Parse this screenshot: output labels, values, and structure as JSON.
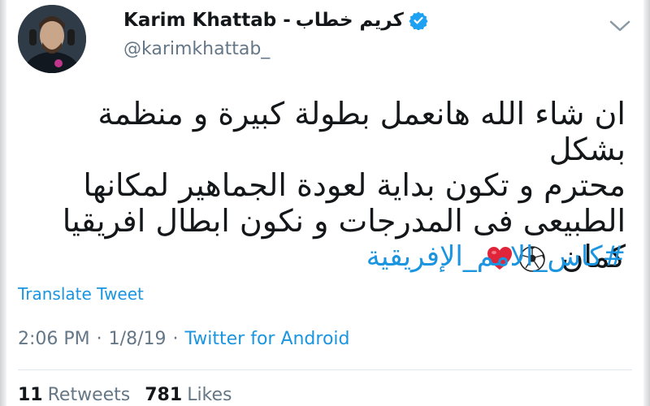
{
  "author": {
    "name_latin": "Karim Khattab -",
    "name_arabic": "كريم خطاب",
    "handle": "@karimkhattab_"
  },
  "tweet": {
    "lines": [
      "ان شاء الله هانعمل بطولة كبيرة و منظمة بشكل",
      "محترم و تكون بداية لعودة الجماهير لمكانها",
      "الطبيعى فى المدرجات و نكون ابطال افريقيا",
      "كمان"
    ],
    "hashtag": "#كاس_الامم_الإفريقية"
  },
  "translate_label": "Translate Tweet",
  "meta": {
    "time": "2:06 PM",
    "sep1": "·",
    "date": "1/8/19",
    "sep2": "·",
    "source": "Twitter for Android"
  },
  "stats": {
    "retweets_count": "11",
    "retweets_label": "Retweets",
    "likes_count": "781",
    "likes_label": "Likes"
  },
  "colors": {
    "link": "#1b95e0",
    "secondary": "#657786",
    "primary": "#14171a"
  }
}
